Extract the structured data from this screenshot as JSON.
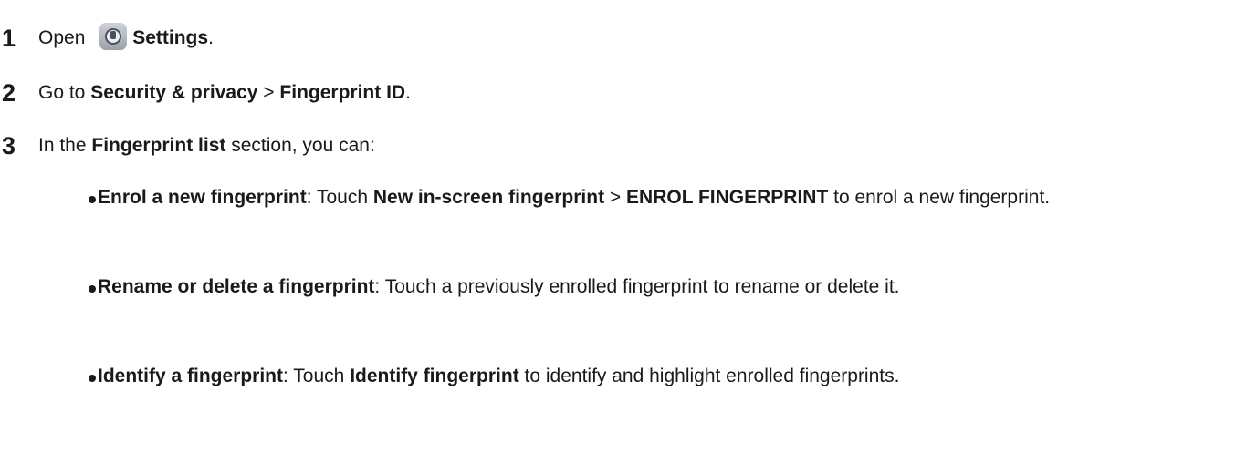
{
  "steps": [
    {
      "number": "1",
      "parts": {
        "pre": "Open ",
        "bold1": "Settings",
        "post": "."
      },
      "icon": "settings-icon"
    },
    {
      "number": "2",
      "parts": {
        "pre": "Go to ",
        "bold1": "Security & privacy",
        "mid": " > ",
        "bold2": "Fingerprint ID",
        "post": "."
      }
    },
    {
      "number": "3",
      "parts": {
        "pre": "In the ",
        "bold1": "Fingerprint list",
        "post": " section, you can:"
      }
    }
  ],
  "bullets": [
    {
      "bold1": "Enrol a new fingerprint",
      "t1": ": Touch ",
      "bold2": "New in-screen fingerprint",
      "t2": " > ",
      "bold3": "ENROL FINGERPRINT",
      "t3": " to enrol a new fingerprint."
    },
    {
      "bold1": "Rename or delete a fingerprint",
      "t1": ": Touch a previously enrolled fingerprint to rename or delete it."
    },
    {
      "bold1": "Identify a fingerprint",
      "t1": ": Touch ",
      "bold2": "Identify fingerprint",
      "t2": " to identify and highlight enrolled fingerprints."
    }
  ]
}
